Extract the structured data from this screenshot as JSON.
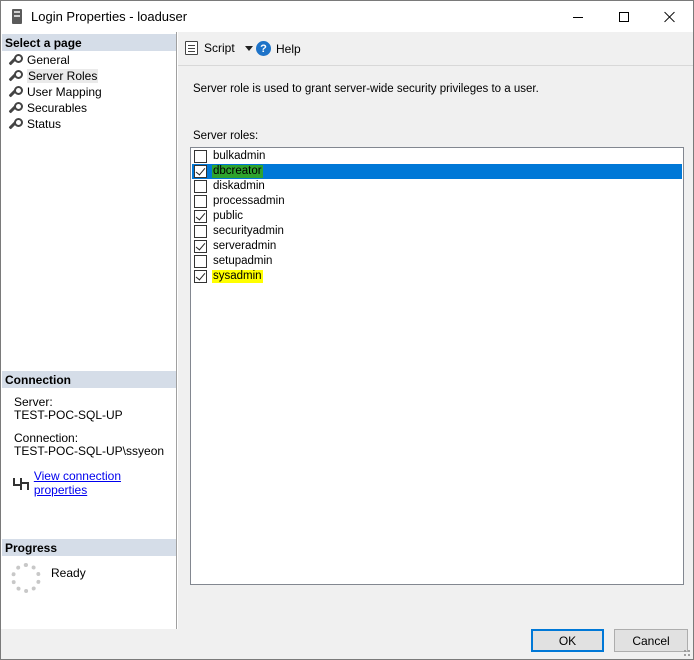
{
  "window": {
    "title": "Login Properties - loaduser",
    "icon": "server-icon",
    "controls": [
      "minimize",
      "maximize",
      "close"
    ]
  },
  "sidebar": {
    "select_page_header": "Select a page",
    "pages": [
      {
        "label": "General",
        "icon": "wrench-icon"
      },
      {
        "label": "Server Roles",
        "icon": "wrench-icon",
        "selected": true
      },
      {
        "label": "User Mapping",
        "icon": "wrench-icon"
      },
      {
        "label": "Securables",
        "icon": "wrench-icon"
      },
      {
        "label": "Status",
        "icon": "wrench-icon"
      }
    ],
    "connection_header": "Connection",
    "server_label": "Server:",
    "server_value": "TEST-POC-SQL-UP",
    "connection_label": "Connection:",
    "connection_value": "TEST-POC-SQL-UP\\ssyeon",
    "view_connection_link": "View connection properties",
    "progress_header": "Progress",
    "progress_status": "Ready"
  },
  "toolbar": {
    "script_label": "Script",
    "help_label": "Help"
  },
  "main": {
    "description": "Server role is used to grant server-wide security privileges to a user.",
    "roles_label": "Server roles:",
    "roles": [
      {
        "name": "bulkadmin",
        "checked": false
      },
      {
        "name": "dbcreator",
        "checked": true,
        "selected": true,
        "highlight": "#2ea32e"
      },
      {
        "name": "diskadmin",
        "checked": false
      },
      {
        "name": "processadmin",
        "checked": false
      },
      {
        "name": "public",
        "checked": true
      },
      {
        "name": "securityadmin",
        "checked": false
      },
      {
        "name": "serveradmin",
        "checked": true
      },
      {
        "name": "setupadmin",
        "checked": false
      },
      {
        "name": "sysadmin",
        "checked": true,
        "highlight": "#ffff00"
      }
    ]
  },
  "footer": {
    "ok_label": "OK",
    "cancel_label": "Cancel"
  },
  "colors": {
    "selection": "#0078d7",
    "section_header": "#d5dde8",
    "link": "#0000ee"
  }
}
